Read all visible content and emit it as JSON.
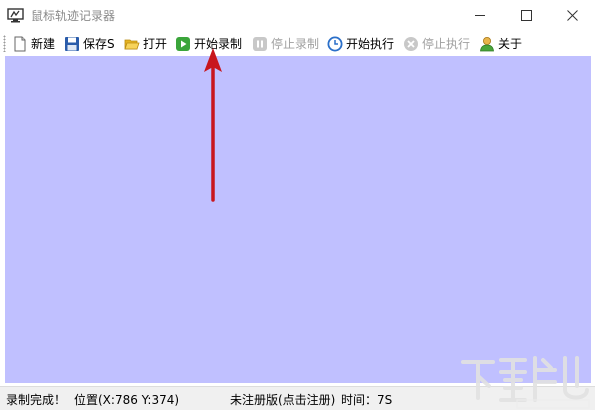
{
  "window": {
    "title": "鼠标轨迹记录器"
  },
  "toolbar": {
    "items": [
      {
        "label": "新建",
        "icon": "new-file-icon",
        "enabled": true
      },
      {
        "label": "保存S",
        "icon": "save-icon",
        "enabled": true
      },
      {
        "label": "打开",
        "icon": "folder-open-icon",
        "enabled": true
      },
      {
        "label": "开始录制",
        "icon": "play-icon",
        "enabled": true
      },
      {
        "label": "停止录制",
        "icon": "pause-icon",
        "enabled": false
      },
      {
        "label": "开始执行",
        "icon": "clock-icon",
        "enabled": true
      },
      {
        "label": "停止执行",
        "icon": "stop-icon",
        "enabled": false
      },
      {
        "label": "关于",
        "icon": "user-icon",
        "enabled": true
      }
    ]
  },
  "canvas": {
    "background": "#c0c0ff"
  },
  "annotation": {
    "arrow_color": "#c8161d"
  },
  "statusbar": {
    "status": "录制完成！",
    "position": "位置(X:786 Y:374)",
    "registration": "未注册版(点击注册)",
    "time": "时间：7S"
  },
  "colors": {
    "disabled_text": "#a0a0a0",
    "title_text": "#8a8a8a"
  }
}
